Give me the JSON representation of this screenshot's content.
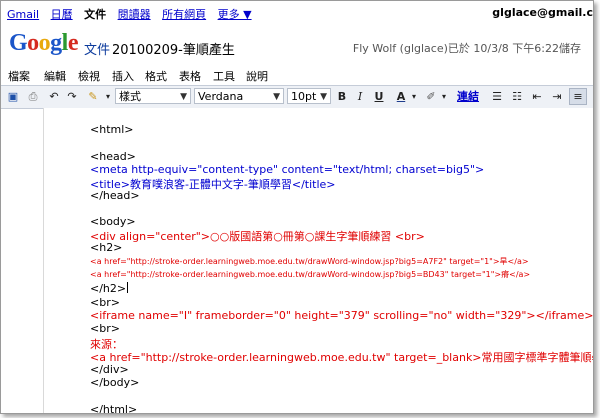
{
  "topnav": {
    "links": [
      "Gmail",
      "日曆",
      "文件",
      "閱讀器",
      "所有網頁",
      "更多 ▼"
    ],
    "email": "glglace@gmail.c"
  },
  "header": {
    "logo": "Google",
    "product": "文件",
    "doc_title": "20100209-筆順產生",
    "save_status": "Fly Wolf (glglace)已於 10/3/8 下午6:22儲存"
  },
  "menu": [
    "檔案",
    "編輯",
    "檢視",
    "插入",
    "格式",
    "表格",
    "工具",
    "說明"
  ],
  "toolbar": {
    "style_select": "樣式",
    "font_select": "Verdana",
    "size_select": "10pt",
    "bold": "B",
    "italic": "I",
    "underline": "U",
    "text_color": "A",
    "link": "連結"
  },
  "doc_lines": [
    {
      "text": "<html>",
      "color": "black",
      "size": "normal"
    },
    {
      "text": "<head>",
      "color": "black",
      "size": "normal"
    },
    {
      "text": "<meta http-equiv=\"content-type\" content=\"text/html; charset=big5\">",
      "color": "blue",
      "size": "normal"
    },
    {
      "text": "<title>教育噗浪客-正體中文字-筆順學習</title>",
      "color": "blue",
      "size": "normal"
    },
    {
      "text": "</head>",
      "color": "black",
      "size": "normal"
    },
    {
      "text": "<body>",
      "color": "black",
      "size": "normal"
    },
    {
      "text": "<div align=\"center\">○○版國語第○冊第○課生字筆順練習 <br>",
      "color": "red",
      "size": "normal"
    },
    {
      "text": "<h2>",
      "color": "black",
      "size": "normal"
    },
    {
      "text": "<a href=\"http://stroke-order.learningweb.moe.edu.tw/drawWord-window.jsp?big5=A7F2\" target=\"1\">旱</a>",
      "color": "red",
      "size": "small"
    },
    {
      "text": "<a href=\"http://stroke-order.learningweb.moe.edu.tw/drawWord-window.jsp?big5=BD43\" target=\"1\">瘠</a>",
      "color": "red",
      "size": "small"
    },
    {
      "text": "</h2>",
      "color": "black",
      "size": "normal"
    },
    {
      "text": "<br>",
      "color": "black",
      "size": "normal"
    },
    {
      "text": "<iframe name=\"I\" frameborder=\"0\" height=\"379\" scrolling=\"no\" width=\"329\"></iframe>",
      "color": "red",
      "size": "normal"
    },
    {
      "text": "<br>",
      "color": "black",
      "size": "normal"
    },
    {
      "text": "來源：",
      "color": "red",
      "size": "normal"
    },
    {
      "text": "<a href=\"http://stroke-order.learningweb.moe.edu.tw\" target=_blank>常用國字標準字體筆順學習網",
      "color": "red",
      "size": "normal"
    },
    {
      "text": "</div>",
      "color": "black",
      "size": "normal"
    },
    {
      "text": "</body>",
      "color": "black",
      "size": "normal"
    },
    {
      "text": "</html>",
      "color": "black",
      "size": "normal"
    }
  ]
}
